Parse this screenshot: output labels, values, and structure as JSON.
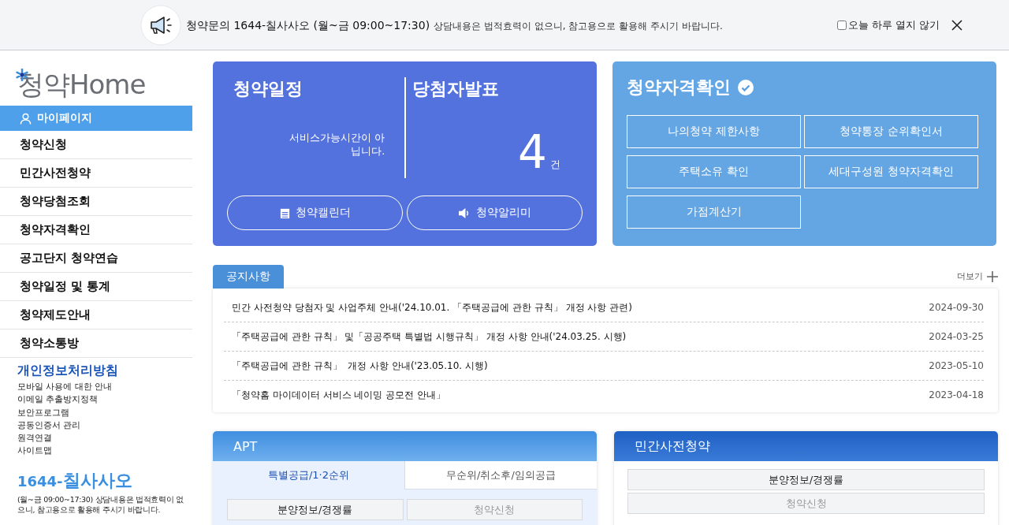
{
  "banner": {
    "message_strong": "청약문의 1644-칠사사오 (월~금 09:00~17:30)",
    "message": "상담내용은 법적효력이 없으니, 참고용으로 활용해 주시기 바랍니다.",
    "dismiss": {
      "label": "오늘 하루 열지 않기",
      "checked": false
    }
  },
  "sidebar": {
    "logo": "청약Home",
    "items": [
      {
        "label": "마이페이지",
        "selected": true
      },
      {
        "label": "청약신청",
        "selected": false
      },
      {
        "label": "민간사전청약",
        "selected": false
      },
      {
        "label": "청약당첨조회",
        "selected": false
      },
      {
        "label": "청약자격확인",
        "selected": false
      },
      {
        "label": "공고단지 청약연습",
        "selected": false
      },
      {
        "label": "청약일정 및 통계",
        "selected": false
      },
      {
        "label": "청약제도안내",
        "selected": false
      },
      {
        "label": "청약소통방",
        "selected": false
      }
    ],
    "privacy": "개인정보처리방침",
    "links": [
      "모바일 사용에 대한 안내",
      "이메일 추출방지정책",
      "보안프로그램",
      "공동인증서 관리",
      "원격연결",
      "사이트맵"
    ],
    "phone_prefix": "1644-",
    "phone_name": "칠사사오",
    "hours": "(월~금 09:00~17:30) 상담내용은 법적효력이 없으니, 참고용으로 활용해 주시기 바랍니다."
  },
  "schedule_card": {
    "title": "청약일정",
    "status": "서비스가능시간이 아닙니다.",
    "winners_title": "당첨자발표",
    "winners_count": "4",
    "winners_unit": "건",
    "buttons": [
      {
        "kind": "calendar",
        "label": "청약캘린더"
      },
      {
        "kind": "speaker",
        "label": "청약알리미"
      }
    ]
  },
  "eligibility_card": {
    "title": "청약자격확인",
    "buttons": [
      "나의청약 제한사항",
      "청약통장 순위확인서",
      "주택소유 확인",
      "세대구성원 청약자격확인",
      "가점계산기"
    ]
  },
  "notices": {
    "tab": "공지사항",
    "more": "더보기",
    "rows": [
      {
        "title": "민간 사전청약 당첨자 및 사업주체 안내('24.10.01. 「주택공급에 관한 규칙」 개정 사항 관련)",
        "date": "2024-09-30"
      },
      {
        "title": "「주택공급에 관한 규칙」 및「공공주택 특별법 시행규칙」 개정 사항 안내('24.03.25. 시행)",
        "date": "2024-03-25"
      },
      {
        "title": "「주택공급에 관한 규칙」  개정 사항 안내('23.05.10. 시행)",
        "date": "2023-05-10"
      },
      {
        "title": "「청약홈 마이데이터 서비스 네이밍 공모전 안내」",
        "date": "2023-04-18"
      }
    ]
  },
  "apt_panel": {
    "title": "APT",
    "tabs": [
      {
        "label": "특별공급/1·2순위",
        "selected": true
      },
      {
        "label": "무순위/취소후/임의공급",
        "selected": false
      }
    ],
    "buttons": [
      {
        "label": "분양정보/경쟁률",
        "disabled": false
      },
      {
        "label": "청약신청",
        "disabled": true
      }
    ]
  },
  "presale_panel": {
    "title": "민간사전청약",
    "buttons": [
      {
        "label": "분양정보/경쟁률",
        "disabled": false
      },
      {
        "label": "청약신청",
        "disabled": true
      }
    ]
  }
}
